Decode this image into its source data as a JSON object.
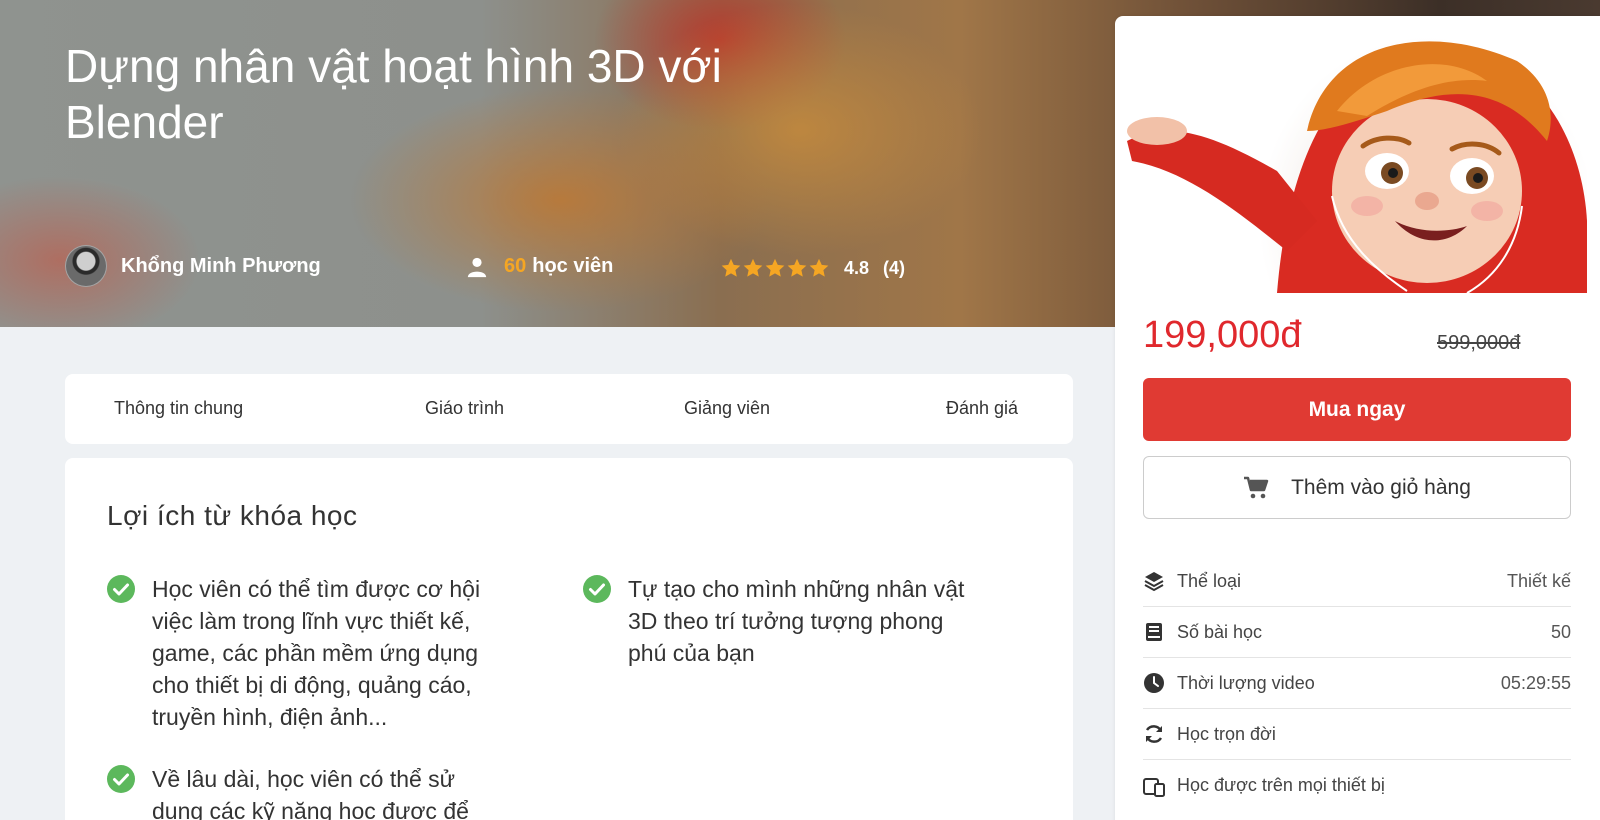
{
  "course": {
    "title": "Dựng nhân vật hoạt hình 3D với Blender",
    "instructor": "Khổng Minh Phương",
    "students_count": "60",
    "students_label": "học viên",
    "rating": "4.8",
    "rating_count": "(4)",
    "stars": 5
  },
  "tabs": [
    "Thông tin chung",
    "Giáo trình",
    "Giảng viên",
    "Đánh giá"
  ],
  "benefits": {
    "heading": "Lợi ích từ khóa học",
    "items": [
      "Học viên có thể tìm được cơ hội việc làm trong lĩnh vực thiết kế, game, các phần mềm ứng dụng cho thiết bị di động, quảng cáo, truyền hình, điện ảnh...",
      "Tự tạo cho mình những nhân vật 3D theo trí tưởng tượng phong phú của bạn",
      "Về lâu dài, học viên có thể sử dụng các kỹ năng học được để tạo ra"
    ]
  },
  "purchase": {
    "price": "199,000đ",
    "old_price": "599,000đ",
    "buy_label": "Mua ngay",
    "cart_label": "Thêm vào giỏ hàng"
  },
  "details": [
    {
      "icon": "layers-icon",
      "label": "Thể loại",
      "value": "Thiết kế"
    },
    {
      "icon": "book-icon",
      "label": "Số bài học",
      "value": "50"
    },
    {
      "icon": "clock-icon",
      "label": "Thời lượng video",
      "value": "05:29:55"
    },
    {
      "icon": "refresh-icon",
      "label": "Học trọn đời",
      "value": ""
    },
    {
      "icon": "devices-icon",
      "label": "Học được trên mọi thiết bị",
      "value": ""
    }
  ],
  "colors": {
    "accent": "#e03a33",
    "price": "#e0282d",
    "star": "#f5a623",
    "check": "#5cb85c"
  }
}
